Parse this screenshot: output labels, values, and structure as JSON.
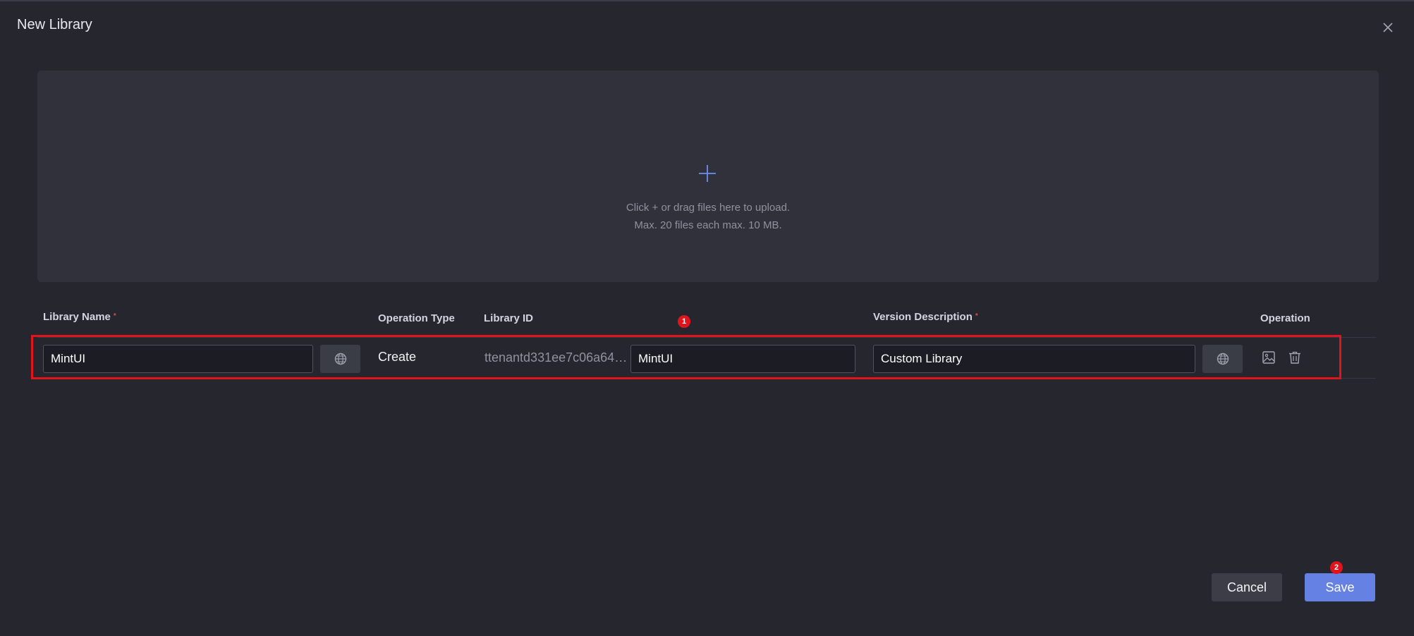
{
  "dialog": {
    "title": "New Library"
  },
  "upload": {
    "hint_line1": "Click + or drag files here to upload.",
    "hint_line2": "Max. 20 files each max. 10 MB."
  },
  "table": {
    "columns": {
      "library_name": "Library Name",
      "operation_type": "Operation Type",
      "library_id": "Library ID",
      "version_description": "Version Description",
      "operation": "Operation"
    },
    "required_mark": "*",
    "row": {
      "library_name": "MintUI",
      "operation_type": "Create",
      "library_id": "ttenantd331ee7c06a64f...",
      "library_id_suffix": "MintUI",
      "version_description": "Custom Library"
    }
  },
  "annotations": {
    "badge_1": "1",
    "badge_2": "2"
  },
  "footer": {
    "cancel_label": "Cancel",
    "save_label": "Save"
  },
  "colors": {
    "background": "#25262e",
    "upload_zone": "#30313b",
    "accent": "#6581e4",
    "highlight": "#e2141b"
  }
}
